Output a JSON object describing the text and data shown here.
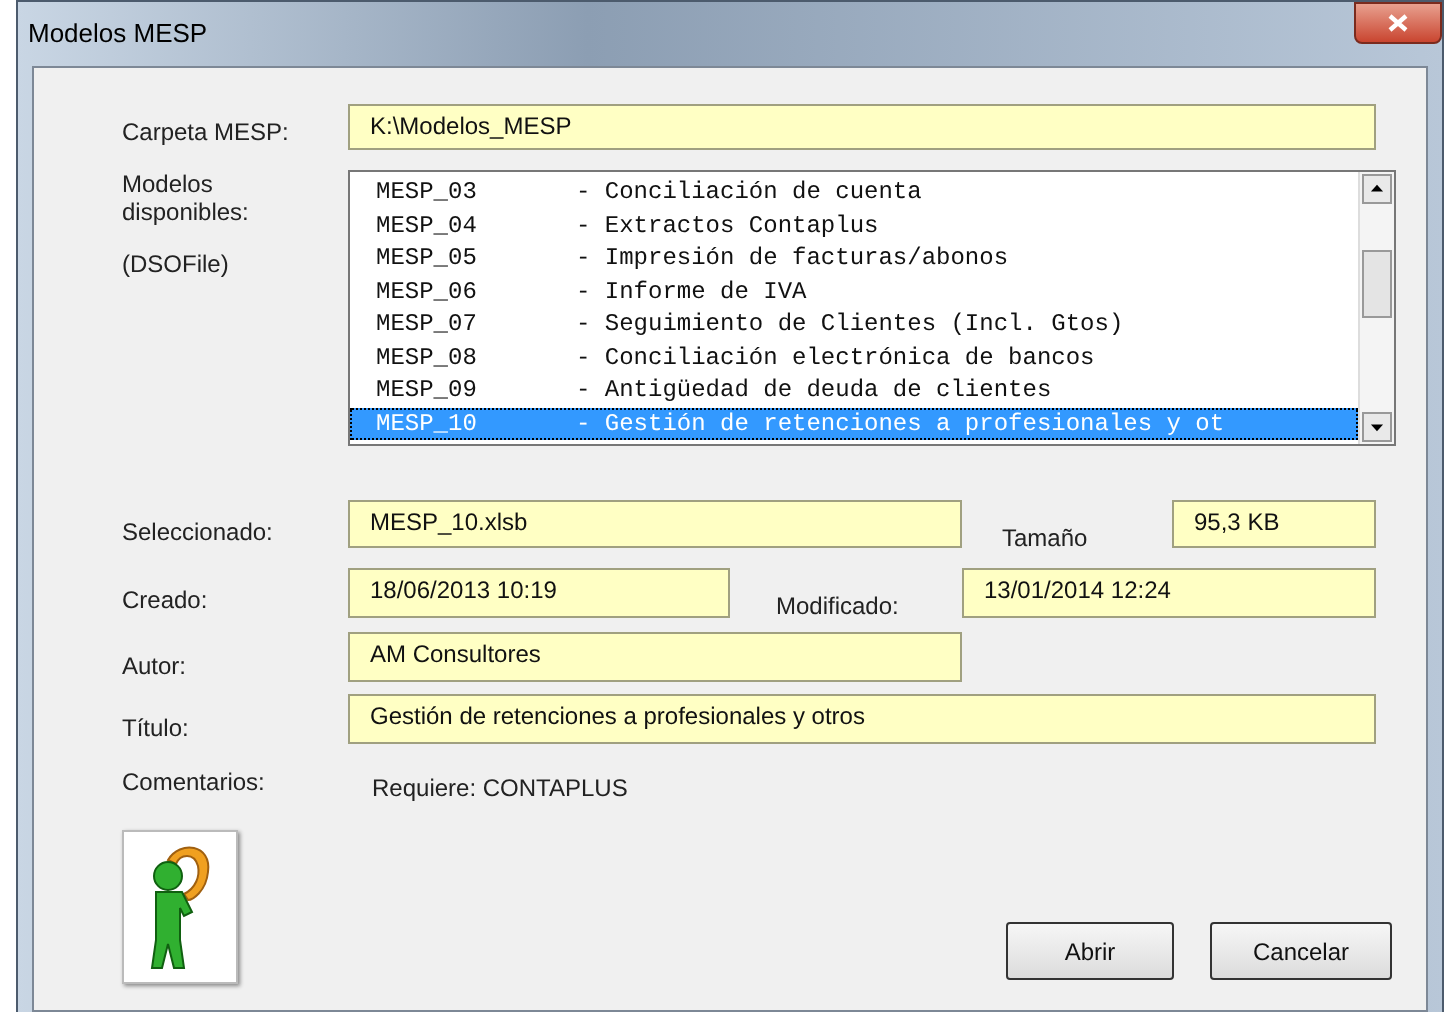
{
  "window": {
    "title": "Modelos MESP"
  },
  "folder": {
    "label": "Carpeta MESP:",
    "value": "K:\\Modelos_MESP"
  },
  "models": {
    "labels": [
      "Modelos disponibles:",
      "(DSOFile)"
    ],
    "items": [
      {
        "code": "MESP_03",
        "description": "- Conciliación de cuenta",
        "selected": false
      },
      {
        "code": "MESP_04",
        "description": "- Extractos Contaplus",
        "selected": false
      },
      {
        "code": "MESP_05",
        "description": "- Impresión de facturas/abonos",
        "selected": false
      },
      {
        "code": "MESP_06",
        "description": "- Informe de IVA",
        "selected": false
      },
      {
        "code": "MESP_07",
        "description": "- Seguimiento de Clientes (Incl. Gtos)",
        "selected": false
      },
      {
        "code": "MESP_08",
        "description": "- Conciliación electrónica de bancos",
        "selected": false
      },
      {
        "code": "MESP_09",
        "description": "- Antigüedad de deuda de clientes",
        "selected": false
      },
      {
        "code": "MESP_10",
        "description": "- Gestión de retenciones a profesionales y ot",
        "selected": true
      }
    ]
  },
  "selected": {
    "label": "Seleccionado:",
    "value": "MESP_10.xlsb"
  },
  "size": {
    "label": "Tamaño",
    "value": "95,3 KB"
  },
  "created": {
    "label": "Creado:",
    "value": "18/06/2013 10:19"
  },
  "modified": {
    "label": "Modificado:",
    "value": "13/01/2014 12:24"
  },
  "author": {
    "label": "Autor:",
    "value": "AM Consultores"
  },
  "title": {
    "label": "Título:",
    "value": "Gestión de retenciones a profesionales y otros"
  },
  "comments": {
    "label": "Comentarios:",
    "value": "Requiere: CONTAPLUS"
  },
  "buttons": [
    "Abrir",
    "Cancelar"
  ]
}
